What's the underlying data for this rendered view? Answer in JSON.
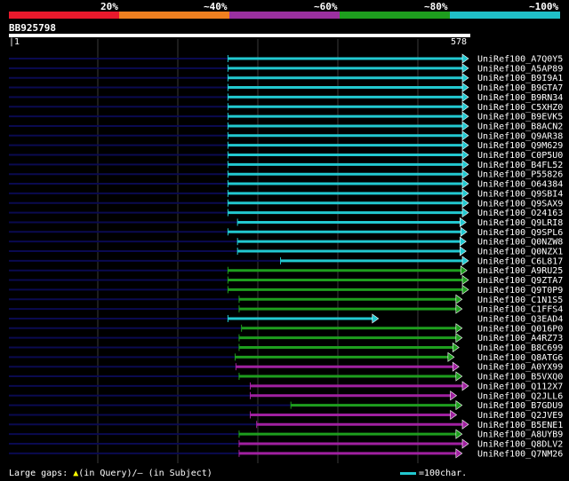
{
  "legend": {
    "colors": [
      "#e8192c",
      "#f08020",
      "#9b30a0",
      "#1e9e1e",
      "#20c0c8"
    ],
    "labels": [
      "20%",
      "~40%",
      "~60%",
      "~80%",
      "~100%"
    ]
  },
  "query": {
    "name": "BB925798",
    "start_label": "1",
    "end_label": "578",
    "length": 578
  },
  "hits": [
    {
      "name": "UniRef100_A7Q0Y5",
      "start": 276,
      "end": 578,
      "color": "cyan"
    },
    {
      "name": "UniRef100_A5AP89",
      "start": 276,
      "end": 578,
      "color": "cyan"
    },
    {
      "name": "UniRef100_B9I9A1",
      "start": 276,
      "end": 578,
      "color": "cyan"
    },
    {
      "name": "UniRef100_B9GTA7",
      "start": 276,
      "end": 578,
      "color": "cyan"
    },
    {
      "name": "UniRef100_B9RN34",
      "start": 276,
      "end": 578,
      "color": "cyan"
    },
    {
      "name": "UniRef100_C5XHZ0",
      "start": 276,
      "end": 578,
      "color": "cyan"
    },
    {
      "name": "UniRef100_B9EVK5",
      "start": 276,
      "end": 578,
      "color": "cyan"
    },
    {
      "name": "UniRef100_B8ACN2",
      "start": 276,
      "end": 578,
      "color": "cyan"
    },
    {
      "name": "UniRef100_Q9AR38",
      "start": 276,
      "end": 578,
      "color": "cyan"
    },
    {
      "name": "UniRef100_Q9M629",
      "start": 276,
      "end": 578,
      "color": "cyan"
    },
    {
      "name": "UniRef100_C0P5U0",
      "start": 276,
      "end": 578,
      "color": "cyan"
    },
    {
      "name": "UniRef100_B4FL52",
      "start": 276,
      "end": 578,
      "color": "cyan"
    },
    {
      "name": "UniRef100_P55826",
      "start": 276,
      "end": 578,
      "color": "cyan"
    },
    {
      "name": "UniRef100_O64384",
      "start": 276,
      "end": 578,
      "color": "cyan"
    },
    {
      "name": "UniRef100_Q9SBI4",
      "start": 276,
      "end": 578,
      "color": "cyan"
    },
    {
      "name": "UniRef100_Q9SAX9",
      "start": 276,
      "end": 578,
      "color": "cyan"
    },
    {
      "name": "UniRef100_O24163",
      "start": 276,
      "end": 578,
      "color": "cyan"
    },
    {
      "name": "UniRef100_Q9LRI8",
      "start": 288,
      "end": 575,
      "color": "cyan"
    },
    {
      "name": "UniRef100_Q9SPL6",
      "start": 276,
      "end": 576,
      "color": "cyan"
    },
    {
      "name": "UniRef100_Q0NZW8",
      "start": 288,
      "end": 575,
      "color": "cyan"
    },
    {
      "name": "UniRef100_Q0NZX1",
      "start": 288,
      "end": 575,
      "color": "cyan"
    },
    {
      "name": "UniRef100_C6L817",
      "start": 342,
      "end": 578,
      "color": "cyan"
    },
    {
      "name": "UniRef100_A9RU25",
      "start": 276,
      "end": 576,
      "color": "green"
    },
    {
      "name": "UniRef100_Q9ZTA7",
      "start": 276,
      "end": 578,
      "color": "green"
    },
    {
      "name": "UniRef100_Q9T0P9",
      "start": 276,
      "end": 578,
      "color": "green"
    },
    {
      "name": "UniRef100_C1N1S5",
      "start": 290,
      "end": 570,
      "color": "green"
    },
    {
      "name": "UniRef100_C1FFS4",
      "start": 290,
      "end": 570,
      "color": "green"
    },
    {
      "name": "UniRef100_Q3EAD4",
      "start": 276,
      "end": 465,
      "color": "cyan"
    },
    {
      "name": "UniRef100_Q016P0",
      "start": 293,
      "end": 570,
      "color": "green"
    },
    {
      "name": "UniRef100_A4RZ73",
      "start": 290,
      "end": 570,
      "color": "green"
    },
    {
      "name": "UniRef100_B8C699",
      "start": 290,
      "end": 566,
      "color": "green"
    },
    {
      "name": "UniRef100_Q8ATG6",
      "start": 285,
      "end": 560,
      "color": "green"
    },
    {
      "name": "UniRef100_A0YX99",
      "start": 286,
      "end": 566,
      "color": "magenta"
    },
    {
      "name": "UniRef100_B5VXQ0",
      "start": 290,
      "end": 570,
      "color": "green"
    },
    {
      "name": "UniRef100_Q112X7",
      "start": 304,
      "end": 578,
      "color": "magenta"
    },
    {
      "name": "UniRef100_Q2JLL6",
      "start": 304,
      "end": 563,
      "color": "magenta"
    },
    {
      "name": "UniRef100_B7GDU9",
      "start": 355,
      "end": 570,
      "color": "green"
    },
    {
      "name": "UniRef100_Q2JVE9",
      "start": 304,
      "end": 563,
      "color": "magenta"
    },
    {
      "name": "UniRef100_B5ENE1",
      "start": 312,
      "end": 578,
      "color": "magenta"
    },
    {
      "name": "UniRef100_A8UYB9",
      "start": 290,
      "end": 570,
      "color": "green"
    },
    {
      "name": "UniRef100_Q8DLV2",
      "start": 290,
      "end": 578,
      "color": "magenta"
    },
    {
      "name": "UniRef100_Q7NM26",
      "start": 290,
      "end": 570,
      "color": "magenta"
    }
  ],
  "hit_colors": {
    "cyan": "#22c8d0",
    "green": "#1e9e1e",
    "magenta": "#a020a0",
    "grid": "#3a3a3a",
    "lead": "#0a0a50"
  },
  "footer": {
    "large_gaps_prefix": "Large gaps: ",
    "in_query": "(in Query)/",
    "dash": "–",
    "in_subject": " (in Subject)",
    "scale_label": "=100char."
  }
}
